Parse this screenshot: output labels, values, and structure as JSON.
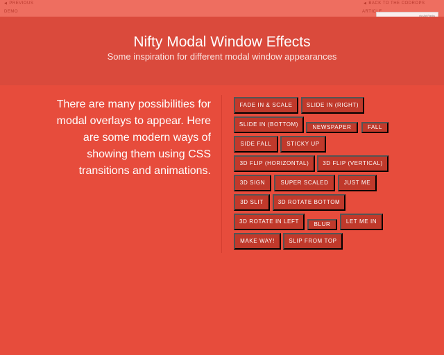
{
  "topbar": {
    "previous_label": "Previous",
    "demo_label": "Demo",
    "back_label": "Back to the Codrops",
    "article_label": "Article",
    "ad_text": "via Ad Packs"
  },
  "header": {
    "title": "Nifty Modal Window Effects",
    "subtitle": "Some inspiration for different modal window appearances"
  },
  "intro": {
    "text": "There are many possibilities for modal overlays to appear. Here are some modern ways of showing them using CSS transitions and animations."
  },
  "buttons": [
    {
      "label": "Fade in & Scale"
    },
    {
      "label": "Slide in (right)"
    },
    {
      "label": "Slide in (bottom)"
    },
    {
      "label": "Newspaper"
    },
    {
      "label": "Fall"
    },
    {
      "label": "Side Fall"
    },
    {
      "label": "Sticky Up"
    },
    {
      "label": "3D Flip (horizontal)"
    },
    {
      "label": "3D Flip (vertical)"
    },
    {
      "label": "3D Sign"
    },
    {
      "label": "Super Scaled"
    },
    {
      "label": "Just Me"
    },
    {
      "label": "3D Slit"
    },
    {
      "label": "3D Rotate Bottom"
    },
    {
      "label": "3D Rotate In Left"
    },
    {
      "label": "Blur"
    },
    {
      "label": "Let me in"
    },
    {
      "label": "Make way!"
    },
    {
      "label": "Slip from top"
    }
  ],
  "colors": {
    "background": "#e74c3c",
    "header": "#da4a3c",
    "button": "#c0392b"
  }
}
